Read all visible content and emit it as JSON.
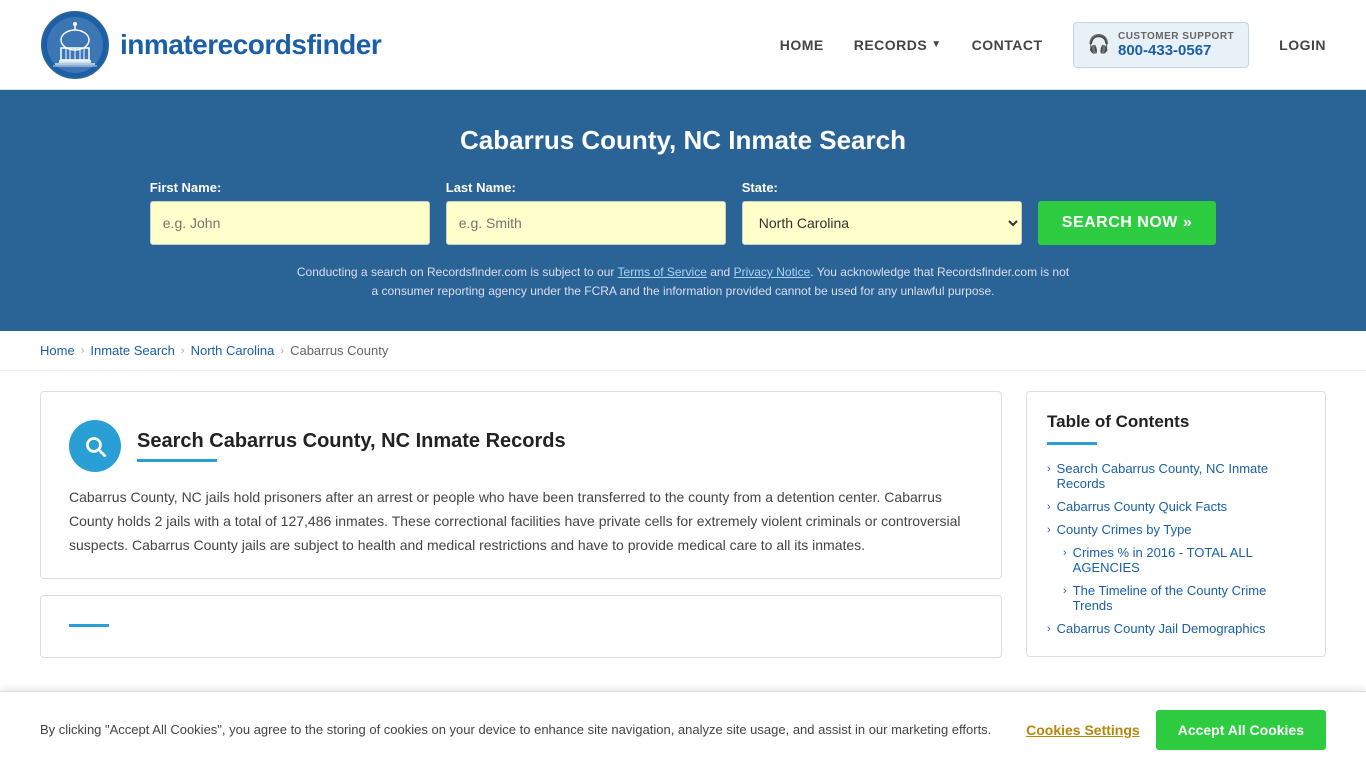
{
  "header": {
    "logo_text_light": "inmaterecords",
    "logo_text_bold": "finder",
    "nav": {
      "home": "HOME",
      "records": "RECORDS",
      "contact": "CONTACT",
      "login": "LOGIN"
    },
    "customer_support": {
      "label": "CUSTOMER SUPPORT",
      "number": "800-433-0567"
    }
  },
  "hero": {
    "title": "Cabarrus County, NC Inmate Search",
    "first_name_label": "First Name:",
    "first_name_placeholder": "e.g. John",
    "last_name_label": "Last Name:",
    "last_name_placeholder": "e.g. Smith",
    "state_label": "State:",
    "state_value": "North Carolina",
    "search_button": "SEARCH NOW »",
    "disclaimer": "Conducting a search on Recordsfinder.com is subject to our Terms of Service and Privacy Notice. You acknowledge that Recordsfinder.com is not a consumer reporting agency under the FCRA and the information provided cannot be used for any unlawful purpose."
  },
  "breadcrumb": {
    "home": "Home",
    "inmate_search": "Inmate Search",
    "north_carolina": "North Carolina",
    "cabarrus_county": "Cabarrus County"
  },
  "article": {
    "title": "Search Cabarrus County, NC Inmate Records",
    "body": "Cabarrus County, NC jails hold prisoners after an arrest or people who have been transferred to the county from a detention center. Cabarrus County holds 2 jails with a total of 127,486 inmates. These correctional facilities have private cells for extremely violent criminals or controversial suspects. Cabarrus County jails are subject to health and medical restrictions and have to provide medical care to all its inmates."
  },
  "toc": {
    "title": "Table of Contents",
    "items": [
      {
        "label": "Search Cabarrus County, NC Inmate Records",
        "sub": false
      },
      {
        "label": "Cabarrus County Quick Facts",
        "sub": false
      },
      {
        "label": "County Crimes by Type",
        "sub": false
      },
      {
        "label": "Crimes % in 2016 - TOTAL ALL AGENCIES",
        "sub": true
      },
      {
        "label": "The Timeline of the County Crime Trends",
        "sub": true
      },
      {
        "label": "Cabarrus County Jail Demographics",
        "sub": false
      }
    ]
  },
  "cookie_banner": {
    "text": "By clicking \"Accept All Cookies\", you agree to the storing of cookies on your device to enhance site navigation, analyze site usage, and assist in our marketing efforts.",
    "settings_label": "Cookies Settings",
    "accept_label": "Accept All Cookies"
  }
}
